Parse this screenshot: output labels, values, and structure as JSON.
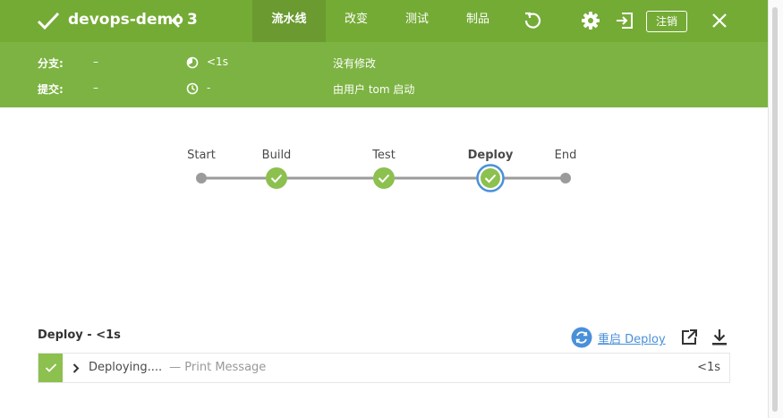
{
  "header": {
    "pipeline_name": "devops-demo",
    "run_number": "3",
    "tabs": [
      {
        "label": "流水线",
        "active": true
      },
      {
        "label": "改变",
        "active": false
      },
      {
        "label": "测试",
        "active": false
      },
      {
        "label": "制品",
        "active": false
      }
    ],
    "logout_label": "注销",
    "bar_color": "#74ab35"
  },
  "run_info": {
    "branch_label": "分支:",
    "branch_value": "–",
    "commit_label": "提交:",
    "commit_value": "–",
    "duration_value": "<1s",
    "time_value": "-",
    "changes_text": "没有修改",
    "trigger_text": "由用户 tom 启动",
    "bar_color": "#7cb342"
  },
  "pipeline_graph": {
    "stages": [
      {
        "label": "Start",
        "status": "start"
      },
      {
        "label": "Build",
        "status": "success"
      },
      {
        "label": "Test",
        "status": "success"
      },
      {
        "label": "Deploy",
        "status": "success",
        "selected": true
      },
      {
        "label": "End",
        "status": "end"
      }
    ],
    "success_color": "#8cc04f",
    "selected_ring_color": "#4a90d9"
  },
  "stage_detail": {
    "title": "Deploy - <1s",
    "restart_label": "重启 Deploy",
    "steps": [
      {
        "text": "Deploying....",
        "subtext": "— Print Message",
        "duration": "<1s",
        "status": "success"
      }
    ]
  }
}
